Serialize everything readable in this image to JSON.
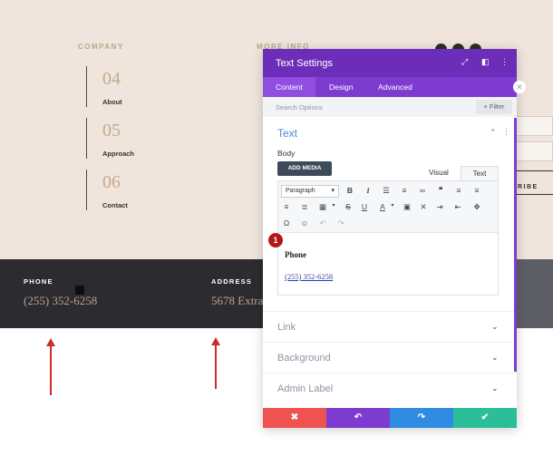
{
  "page": {
    "company_heading": "COMPANY",
    "more_info_heading": "MORE INFO",
    "nav": [
      {
        "num": "04",
        "label": "About"
      },
      {
        "num": "05",
        "label": "Approach"
      },
      {
        "num": "06",
        "label": "Contact"
      }
    ],
    "subscribe_partial": "RIBE",
    "footer": {
      "phone_label": "PHONE",
      "phone_value": "(255) 352-6258",
      "address_label": "ADDRESS",
      "address_value": "5678 Extra"
    },
    "colors": {
      "accent_purple": "#6c2eb9",
      "arrow_red": "#cc2b2b"
    }
  },
  "panel": {
    "title": "Text Settings",
    "header_icons": [
      "expand-icon",
      "split-icon",
      "more-icon"
    ],
    "tabs": [
      "Content",
      "Design",
      "Advanced"
    ],
    "active_tab": "Content",
    "search_placeholder": "Search Options",
    "filter_label": "+ Filter",
    "section_title": "Text",
    "body_label": "Body",
    "add_media_label": "ADD MEDIA",
    "visual_tab": "Visual",
    "text_tab": "Text",
    "format_select": "Paragraph",
    "editor_heading": "Phone",
    "editor_link": "(255) 352-6258",
    "marker_number": "1",
    "accordions": [
      "Link",
      "Background",
      "Admin Label"
    ],
    "footer_buttons": [
      {
        "name": "cancel",
        "glyph": "✖",
        "color": "#ef5350"
      },
      {
        "name": "undo",
        "glyph": "↶",
        "color": "#7e3bd0"
      },
      {
        "name": "redo",
        "glyph": "↷",
        "color": "#2f8ce0"
      },
      {
        "name": "save",
        "glyph": "✔",
        "color": "#2bbf99"
      }
    ]
  }
}
